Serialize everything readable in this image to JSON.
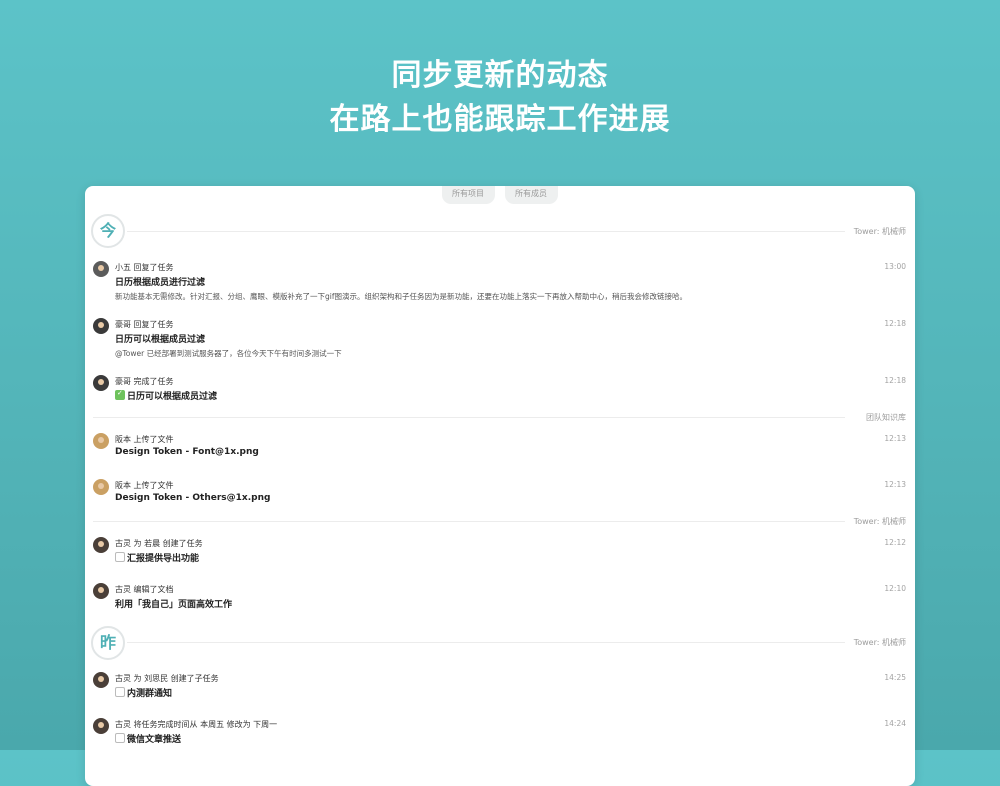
{
  "header": {
    "line1": "同步更新的动态",
    "line2": "在路上也能跟踪工作进展"
  },
  "filters": [
    "所有项目",
    "所有成员"
  ],
  "days": {
    "today": "今",
    "yesterday": "昨"
  },
  "groups": {
    "tower_engineer": "Tower: 机械师",
    "team_knowledge": "团队知识库"
  },
  "activities": [
    {
      "actor": "小五 回复了任务",
      "time": "13:00",
      "title": "日历根据成员进行过滤",
      "detail": "新功能基本无需修改。针对汇报、分组、鹰眼、模版补充了一下gif图演示。组织架构和子任务因为是新功能，还要在功能上落实一下再放入帮助中心，稍后我会修改链接哈。"
    },
    {
      "actor": "豪哥 回复了任务",
      "time": "12:18",
      "title": "日历可以根据成员过滤",
      "detail": "@Tower 已经部署到测试服务器了，各位今天下午有时间多测试一下"
    },
    {
      "actor": "豪哥 完成了任务",
      "time": "12:18",
      "title": "日历可以根据成员过滤",
      "checked": true
    },
    {
      "actor": "阪本 上传了文件",
      "time": "12:13",
      "title": "Design Token - Font@1x.png"
    },
    {
      "actor": "阪本 上传了文件",
      "time": "12:13",
      "title": "Design Token - Others@1x.png"
    },
    {
      "actor": "古灵 为 若晨 创建了任务",
      "time": "12:12",
      "title": "汇报提供导出功能",
      "checked": false
    },
    {
      "actor": "古灵 编辑了文档",
      "time": "12:10",
      "title": "利用「我自己」页面高效工作"
    },
    {
      "actor": "古灵 为 刘思民 创建了子任务",
      "time": "14:25",
      "title": "内测群通知",
      "checked": false
    },
    {
      "actor": "古灵 将任务完成时间从 本周五 修改为 下周一",
      "time": "14:24",
      "title": "微信文章推送",
      "checked": false
    }
  ]
}
